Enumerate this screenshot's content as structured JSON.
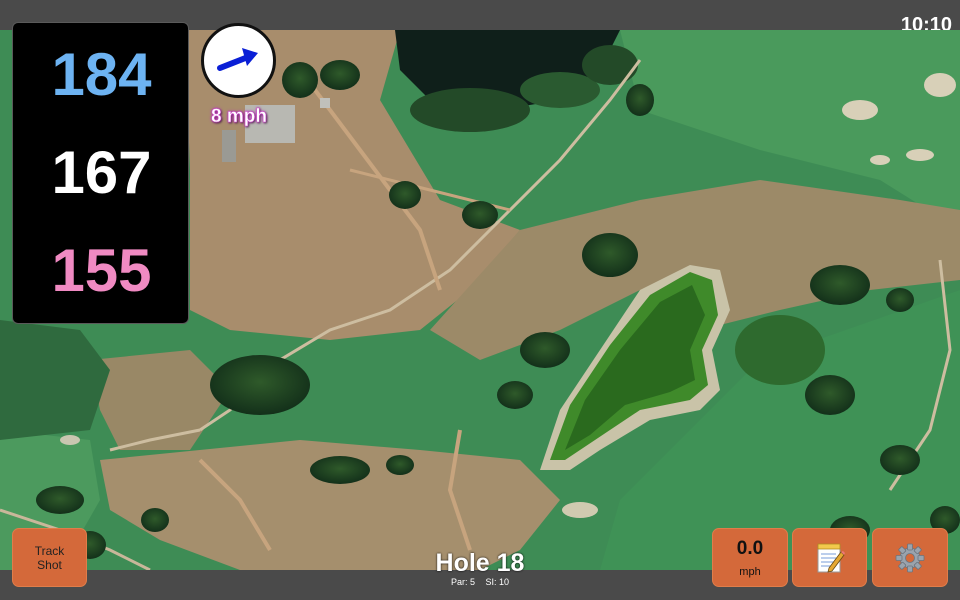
{
  "status": {
    "time": "10:10"
  },
  "distances": {
    "back": {
      "value": "184",
      "color": "#6db3f2"
    },
    "middle": {
      "value": "167",
      "color": "#ffffff"
    },
    "front": {
      "value": "155",
      "color": "#f08ac2"
    }
  },
  "wind": {
    "speed": "8 mph",
    "direction_icon": "arrow-up-right-icon",
    "arrow_color": "#0a1fd6"
  },
  "hole": {
    "title": "Hole 18",
    "par": "Par: 5",
    "stroke_index": "SI: 10"
  },
  "buttons": {
    "track_shot_line1": "Track",
    "track_shot_line2": "Shot",
    "speed_value": "0.0",
    "speed_unit": "mph",
    "notes_icon": "notepad-icon",
    "settings_icon": "gear-icon",
    "accent": "#d4693a"
  }
}
